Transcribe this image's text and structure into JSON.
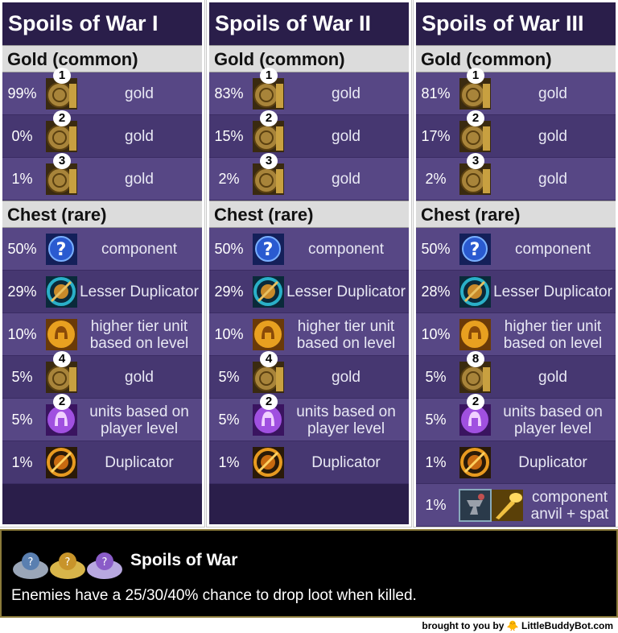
{
  "panels": [
    {
      "title": "Spoils of War I",
      "gold_header": "Gold (common)",
      "gold_rows": [
        {
          "pct": "99%",
          "badge": "1",
          "label": "gold"
        },
        {
          "pct": "0%",
          "badge": "2",
          "label": "gold"
        },
        {
          "pct": "1%",
          "badge": "3",
          "label": "gold"
        }
      ],
      "chest_header": "Chest (rare)",
      "chest_rows": [
        {
          "pct": "50%",
          "icon": "component-orb-icon",
          "label": "component"
        },
        {
          "pct": "29%",
          "icon": "lesser-duplicator-icon",
          "label": "Lesser Duplicator"
        },
        {
          "pct": "10%",
          "icon": "helmet-coin-icon",
          "label": "higher tier unit based on level"
        },
        {
          "pct": "5%",
          "icon": "gold-coins-icon",
          "badge": "4",
          "label": "gold"
        },
        {
          "pct": "5%",
          "icon": "purple-helmet-icon",
          "badge": "2",
          "label": "units based on player level"
        },
        {
          "pct": "1%",
          "icon": "duplicator-icon",
          "label": "Duplicator"
        }
      ]
    },
    {
      "title": "Spoils of War II",
      "gold_header": "Gold (common)",
      "gold_rows": [
        {
          "pct": "83%",
          "badge": "1",
          "label": "gold"
        },
        {
          "pct": "15%",
          "badge": "2",
          "label": "gold"
        },
        {
          "pct": "2%",
          "badge": "3",
          "label": "gold"
        }
      ],
      "chest_header": "Chest (rare)",
      "chest_rows": [
        {
          "pct": "50%",
          "icon": "component-orb-icon",
          "label": "component"
        },
        {
          "pct": "29%",
          "icon": "lesser-duplicator-icon",
          "label": "Lesser Duplicator"
        },
        {
          "pct": "10%",
          "icon": "helmet-coin-icon",
          "label": "higher tier unit based on level"
        },
        {
          "pct": "5%",
          "icon": "gold-coins-icon",
          "badge": "4",
          "label": "gold"
        },
        {
          "pct": "5%",
          "icon": "purple-helmet-icon",
          "badge": "2",
          "label": "units based on player level"
        },
        {
          "pct": "1%",
          "icon": "duplicator-icon",
          "label": "Duplicator"
        }
      ]
    },
    {
      "title": "Spoils of War III",
      "gold_header": "Gold (common)",
      "gold_rows": [
        {
          "pct": "81%",
          "badge": "1",
          "label": "gold"
        },
        {
          "pct": "17%",
          "badge": "2",
          "label": "gold"
        },
        {
          "pct": "2%",
          "badge": "3",
          "label": "gold"
        }
      ],
      "chest_header": "Chest (rare)",
      "chest_rows": [
        {
          "pct": "50%",
          "icon": "component-orb-icon",
          "label": "component"
        },
        {
          "pct": "28%",
          "icon": "lesser-duplicator-icon",
          "label": "Lesser Duplicator"
        },
        {
          "pct": "10%",
          "icon": "helmet-coin-icon",
          "label": "higher tier unit based on level"
        },
        {
          "pct": "5%",
          "icon": "gold-coins-icon",
          "badge": "8",
          "label": "gold"
        },
        {
          "pct": "5%",
          "icon": "purple-helmet-icon",
          "badge": "2",
          "label": "units based on player level"
        },
        {
          "pct": "1%",
          "icon": "duplicator-icon",
          "label": "Duplicator"
        },
        {
          "pct": "1%",
          "icon": "anvil-spatula-icon",
          "label": "component anvil + spat"
        }
      ]
    }
  ],
  "augment": {
    "title": "Spoils of War",
    "description": "Enemies have a 25/30/40% chance to drop loot when killed."
  },
  "credit": "brought to you by 🐥 LittleBuddyBot.com",
  "colors": {
    "panel": "#2a1e4a",
    "row_light": "#574785",
    "row_dark": "#463771",
    "header": "#dcdcdc"
  }
}
